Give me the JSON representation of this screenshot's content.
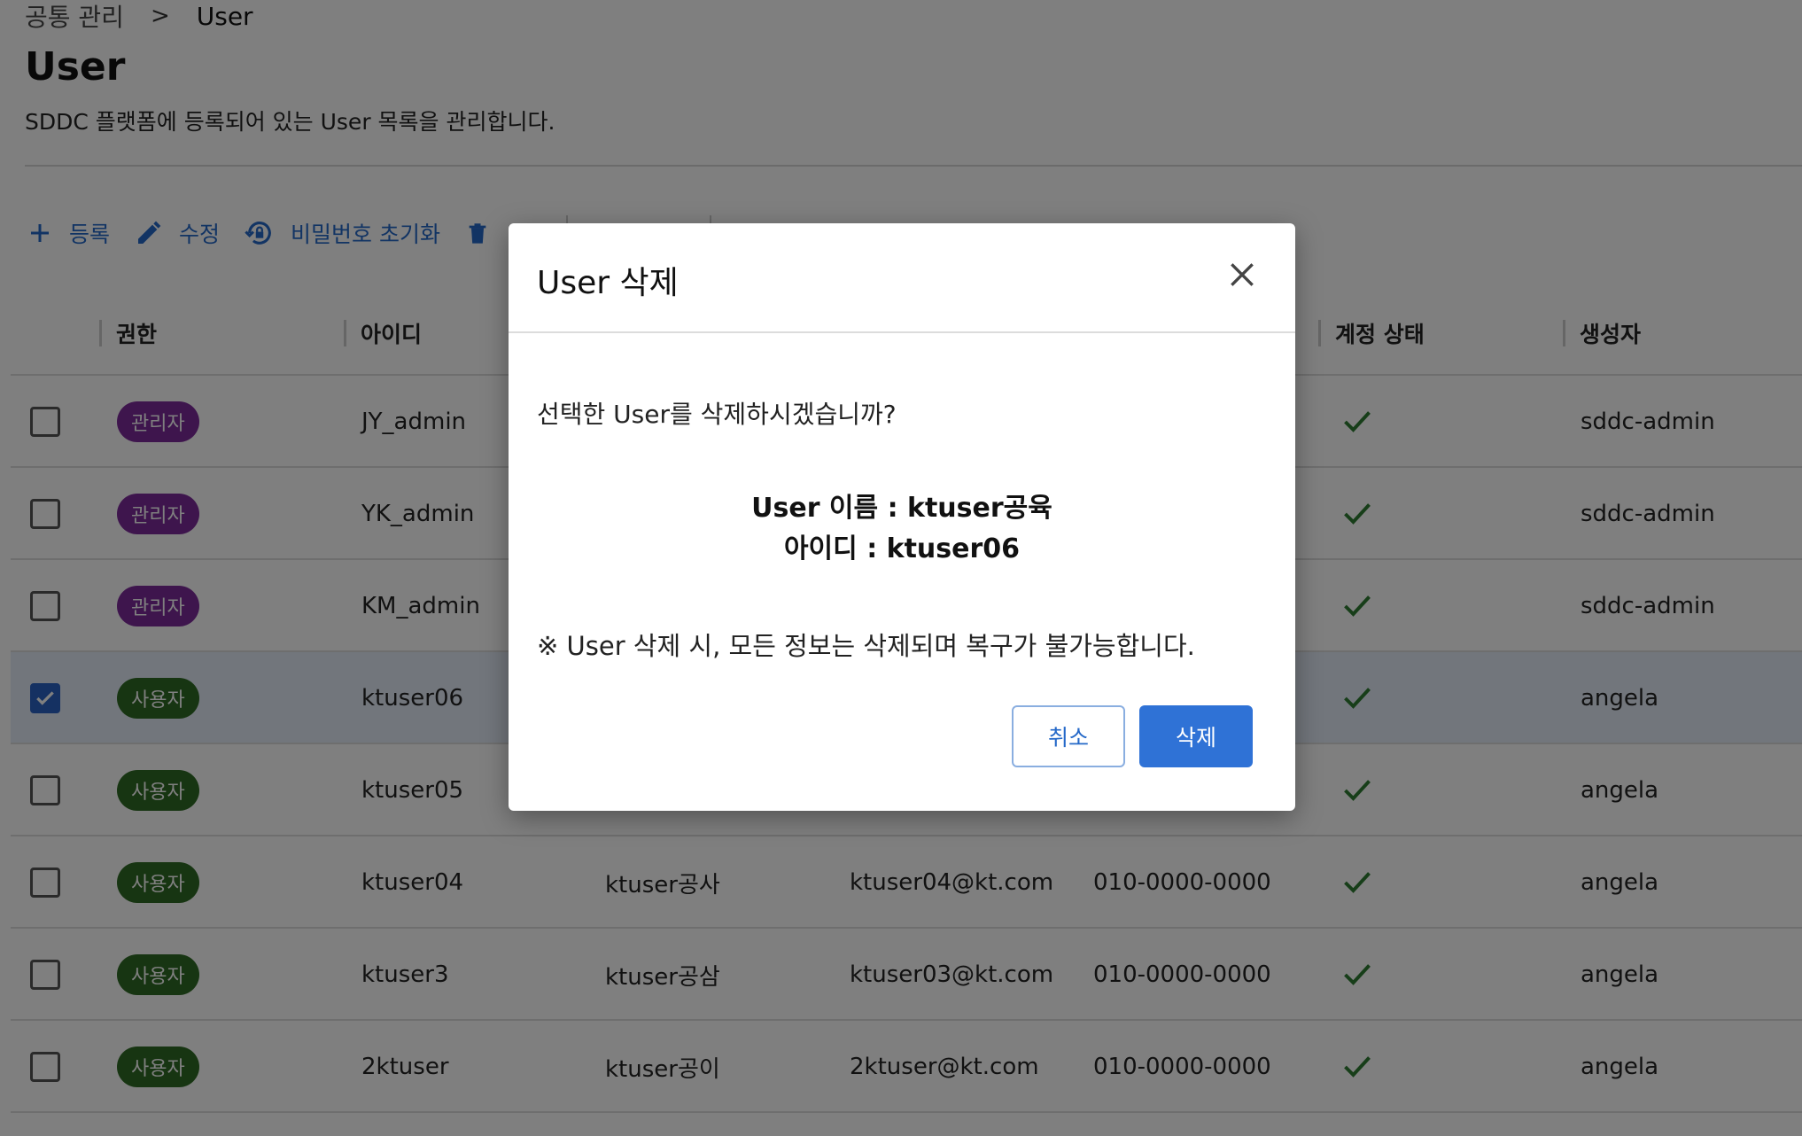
{
  "breadcrumb": {
    "parent": "공통 관리",
    "separator": ">",
    "current": "User"
  },
  "page": {
    "title": "User",
    "description": "SDDC 플랫폼에 등록되어 있는 User 목록을 관리합니다."
  },
  "toolbar": {
    "register": "등록",
    "edit": "수정",
    "reset_password": "비밀번호 초기화"
  },
  "table": {
    "headers": {
      "role": "권한",
      "id": "아이디",
      "status": "계정 상태",
      "creator": "생성자"
    },
    "rows": [
      {
        "checked": false,
        "role": "관리자",
        "role_type": "admin",
        "id": "JY_admin",
        "name": "",
        "email": "",
        "phone": "",
        "status_icon": "check-icon",
        "creator": "sddc-admin"
      },
      {
        "checked": false,
        "role": "관리자",
        "role_type": "admin",
        "id": "YK_admin",
        "name": "",
        "email": "",
        "phone": "",
        "status_icon": "check-icon",
        "creator": "sddc-admin"
      },
      {
        "checked": false,
        "role": "관리자",
        "role_type": "admin",
        "id": "KM_admin",
        "name": "",
        "email": "",
        "phone": "",
        "status_icon": "check-icon",
        "creator": "sddc-admin"
      },
      {
        "checked": true,
        "role": "사용자",
        "role_type": "user",
        "id": "ktuser06",
        "name": "",
        "email": "",
        "phone": "",
        "status_icon": "check-icon",
        "creator": "angela"
      },
      {
        "checked": false,
        "role": "사용자",
        "role_type": "user",
        "id": "ktuser05",
        "name": "",
        "email": "",
        "phone": "",
        "status_icon": "check-icon",
        "creator": "angela"
      },
      {
        "checked": false,
        "role": "사용자",
        "role_type": "user",
        "id": "ktuser04",
        "name": "ktuser공사",
        "email": "ktuser04@kt.com",
        "phone": "010-0000-0000",
        "status_icon": "check-icon",
        "creator": "angela"
      },
      {
        "checked": false,
        "role": "사용자",
        "role_type": "user",
        "id": "ktuser3",
        "name": "ktuser공삼",
        "email": "ktuser03@kt.com",
        "phone": "010-0000-0000",
        "status_icon": "check-icon",
        "creator": "angela"
      },
      {
        "checked": false,
        "role": "사용자",
        "role_type": "user",
        "id": "2ktuser",
        "name": "ktuser공이",
        "email": "2ktuser@kt.com",
        "phone": "010-0000-0000",
        "status_icon": "check-icon",
        "creator": "angela"
      }
    ]
  },
  "modal": {
    "title": "User 삭제",
    "confirm": "선택한 User를 삭제하시겠습니까?",
    "user_name_line": "User 이름 : ktuser공육",
    "user_id_line": "아이디 : ktuser06",
    "warning": "※ User 삭제 시, 모든 정보는 삭제되며 복구가 불가능합니다.",
    "cancel_label": "취소",
    "delete_label": "삭제"
  },
  "colors": {
    "accent": "#2f72d6",
    "admin_badge": "#7d2b9b",
    "user_badge": "#2f6b24",
    "status_check": "#2e7d32"
  }
}
